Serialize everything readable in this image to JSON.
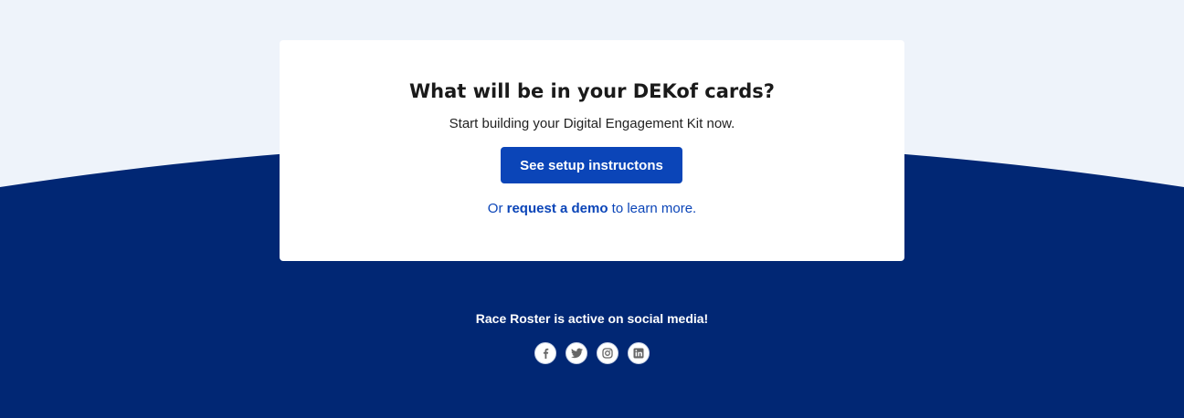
{
  "colors": {
    "page_bg": "#eef3fa",
    "wave_bg": "#012774",
    "card_bg": "#ffffff",
    "accent": "#0b45b8",
    "icon": "#666666"
  },
  "card": {
    "title": "What will be in your DEKof cards?",
    "subtitle": "Start building your Digital Engagement Kit now.",
    "cta_label": "See setup instructons",
    "demo_prefix": "Or ",
    "demo_link": "request a demo",
    "demo_suffix": " to learn more."
  },
  "social": {
    "title": "Race Roster is active on social media!",
    "icons": [
      "facebook-icon",
      "twitter-icon",
      "instagram-icon",
      "linkedin-icon"
    ]
  }
}
